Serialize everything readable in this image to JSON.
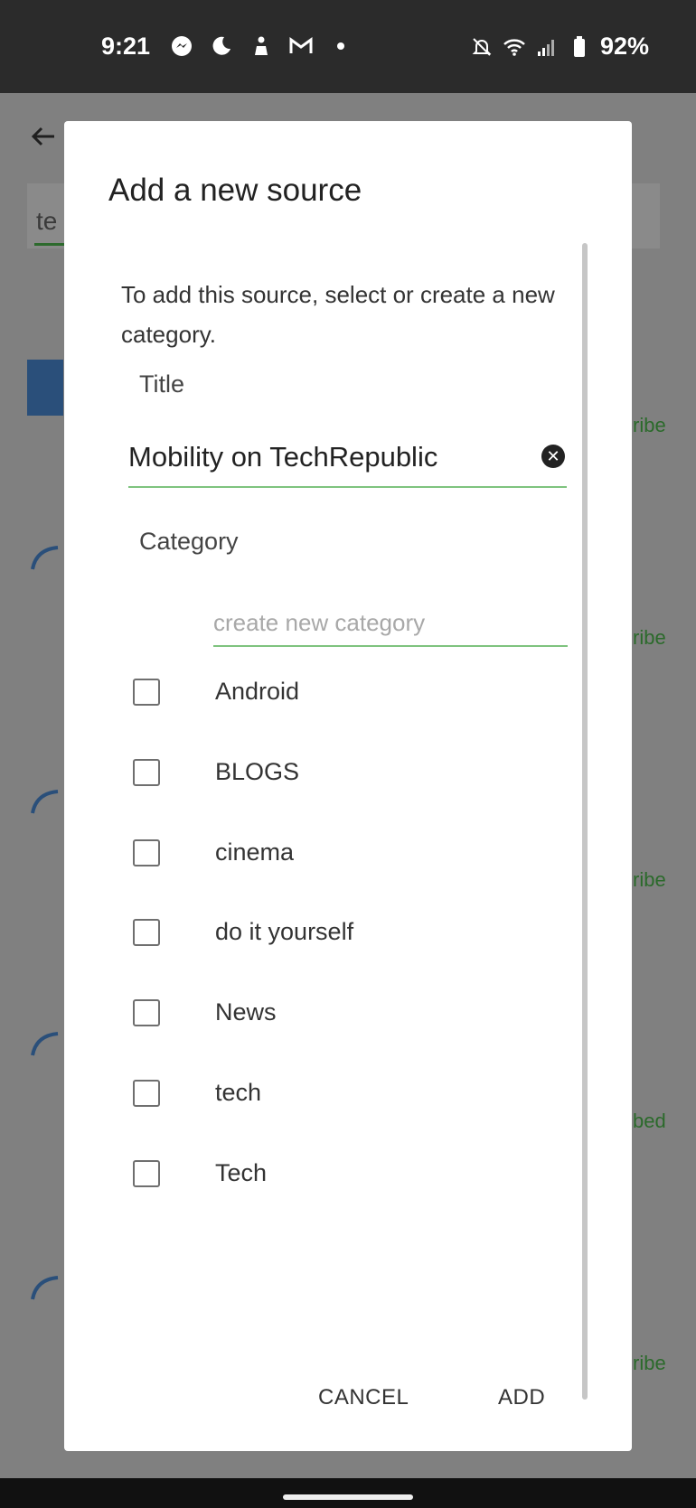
{
  "status_bar": {
    "time": "9:21",
    "battery_percent": "92%",
    "left_icons": [
      "messenger-icon",
      "moon-icon",
      "cleaning-icon",
      "gmail-icon",
      "dot-icon"
    ],
    "right_icons": [
      "bell-off-icon",
      "wifi-icon",
      "signal-icon",
      "battery-icon"
    ]
  },
  "background": {
    "search_text": "te",
    "subscribe_fragments": [
      "ribe",
      "ribe",
      "ribe",
      "bed",
      "ribe"
    ]
  },
  "dialog": {
    "title": "Add a new source",
    "description": "To add this source, select or create a new category.",
    "title_label": "Title",
    "title_value": "Mobility on TechRepublic",
    "category_label": "Category",
    "category_placeholder": "create new category",
    "categories": [
      {
        "label": "Android",
        "checked": false
      },
      {
        "label": "BLOGS",
        "checked": false
      },
      {
        "label": "cinema",
        "checked": false
      },
      {
        "label": "do it yourself",
        "checked": false
      },
      {
        "label": "News",
        "checked": false
      },
      {
        "label": "tech",
        "checked": false
      },
      {
        "label": "Tech",
        "checked": false
      }
    ],
    "cancel_label": "CANCEL",
    "add_label": "ADD"
  },
  "colors": {
    "accent_green": "#7ec37e",
    "scrim": "#808080",
    "status_bar_bg": "#2b2b2b"
  }
}
